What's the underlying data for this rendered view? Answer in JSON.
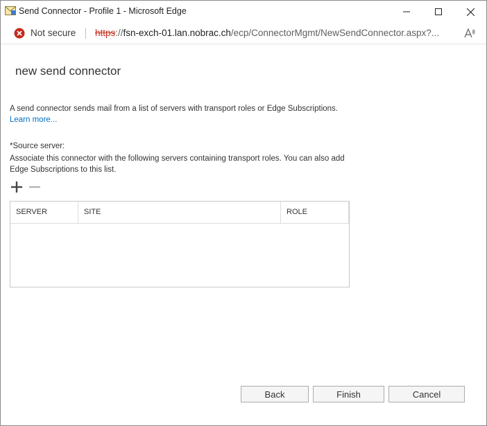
{
  "window": {
    "title": "Send Connector - Profile 1 - Microsoft Edge",
    "icons": {
      "app": "envelope-icon",
      "minimize": "minimize-icon",
      "maximize": "maximize-icon",
      "close": "close-icon"
    }
  },
  "address_bar": {
    "security_text": "Not secure",
    "security_icon": "error-circle-icon",
    "url_scheme": "https",
    "url_separator": "://",
    "url_host": "fsn-exch-01.lan.nobrac.ch",
    "url_path": "/ecp/ConnectorMgmt/NewSendConnector.aspx?...",
    "read_aloud_icon": "read-aloud-icon"
  },
  "page": {
    "title": "new send connector",
    "description": "A send connector sends mail from a list of servers with transport roles or Edge Subscriptions.",
    "learn_more": "Learn more...",
    "source_label": "*Source server:",
    "source_description": "Associate this connector with the following servers containing transport roles. You can also add Edge Subscriptions to this list."
  },
  "toolbar": {
    "add_icon": "plus-icon",
    "remove_icon": "minus-icon"
  },
  "grid": {
    "columns": [
      "SERVER",
      "SITE",
      "ROLE"
    ],
    "rows": []
  },
  "buttons": {
    "back": "Back",
    "finish": "Finish",
    "cancel": "Cancel"
  },
  "colors": {
    "link": "#0072c6",
    "error": "#c42b1c"
  }
}
